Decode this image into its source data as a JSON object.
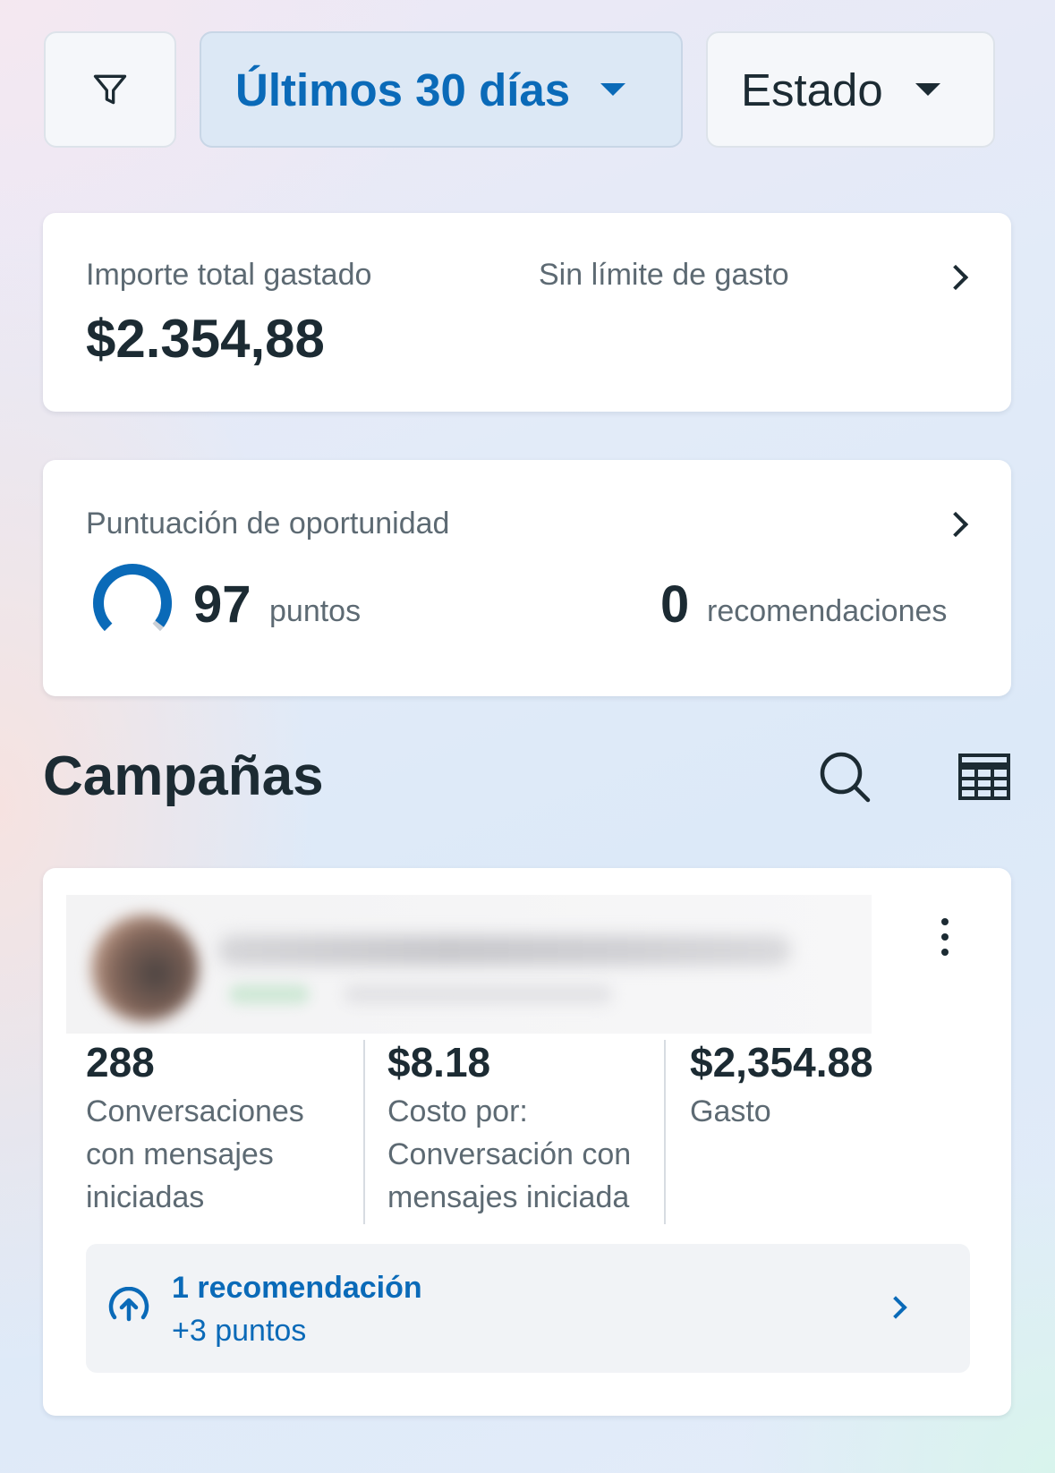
{
  "filters": {
    "filter_icon": "filter-funnel-icon",
    "date_range_label": "Últimos 30 días",
    "status_label": "Estado"
  },
  "spend_card": {
    "label": "Importe total gastado",
    "value": "$2.354,88",
    "limit_label": "Sin límite de gasto"
  },
  "opportunity_card": {
    "label": "Puntuación de oportunidad",
    "score": "97",
    "score_unit": "puntos",
    "score_fraction": 0.97,
    "recommendations_count": "0",
    "recommendations_unit": "recomendaciones"
  },
  "campaigns": {
    "title": "Campañas",
    "search_icon": "search-icon",
    "table_icon": "table-icon",
    "items": [
      {
        "metrics": [
          {
            "value": "288",
            "label": "Conversaciones con mensajes iniciadas"
          },
          {
            "value": "$8.18",
            "label": "Costo por: Conversación con mensajes iniciada"
          },
          {
            "value": "$2,354.88",
            "label": "Gasto"
          }
        ],
        "recommendation": {
          "title": "1 recomendación",
          "subtitle": "+3 puntos"
        }
      }
    ]
  },
  "colors": {
    "accent_blue": "#0a6ab8",
    "text_dark": "#1c2b33",
    "text_grey": "#5d6a73"
  }
}
